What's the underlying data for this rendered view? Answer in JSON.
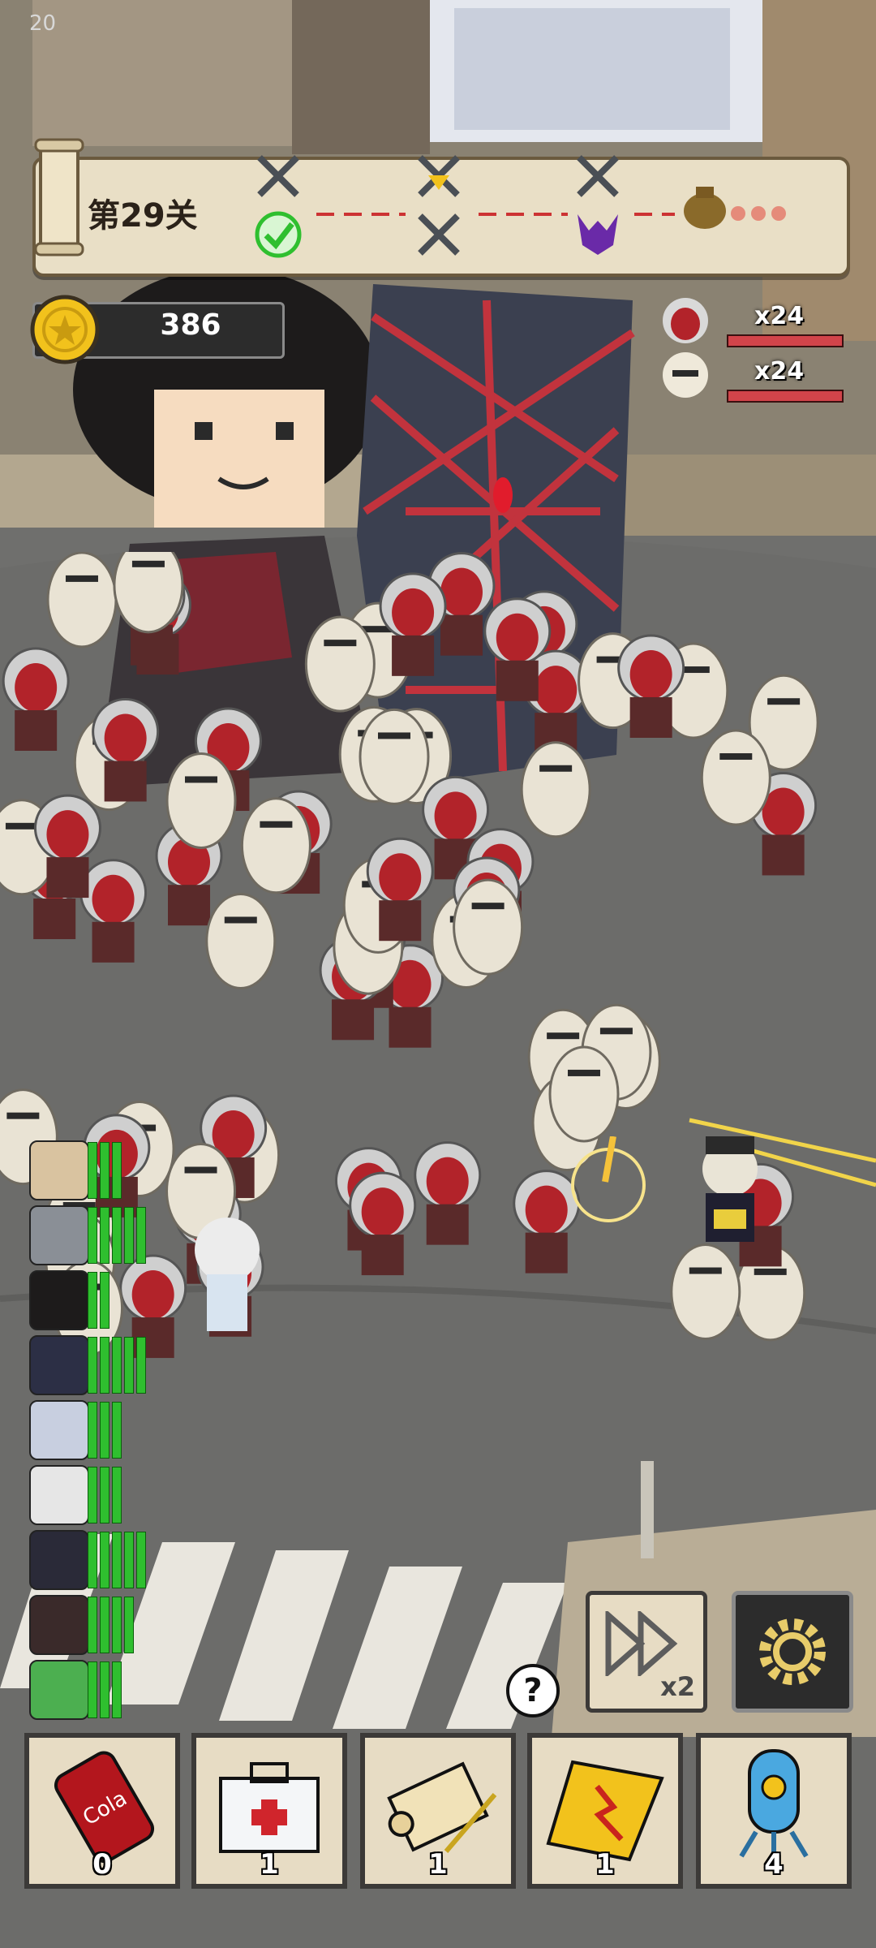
{
  "hud": {
    "fps_counter": "20",
    "stage": {
      "label": "第29关"
    },
    "coins": {
      "value": "386"
    },
    "enemy_waves": [
      {
        "type": "red-masked-hooded",
        "count": "x24",
        "hp_fraction": 1.0
      },
      {
        "type": "white-bandaged",
        "count": "x24",
        "hp_fraction": 1.0
      }
    ]
  },
  "heroes": [
    {
      "name": "cat-cowboy",
      "hp_segments": 3
    },
    {
      "name": "grey-wolf",
      "hp_segments": 5
    },
    {
      "name": "glasses-man",
      "hp_segments": 2
    },
    {
      "name": "ninja",
      "hp_segments": 5
    },
    {
      "name": "pigeon",
      "hp_segments": 3
    },
    {
      "name": "white-hair-elder",
      "hp_segments": 3
    },
    {
      "name": "skeleton-king",
      "hp_segments": 5
    },
    {
      "name": "shield-boy",
      "hp_segments": 4
    },
    {
      "name": "frog",
      "hp_segments": 3
    }
  ],
  "controls": {
    "speed_button": {
      "label": "x2",
      "icon": "fast-forward-icon"
    },
    "settings_button": {
      "icon": "gear-icon"
    },
    "help_button": {
      "label": "?"
    }
  },
  "items": [
    {
      "name": "cola-can",
      "icon": "cola-can-icon",
      "count": "0",
      "can_label": "Cola"
    },
    {
      "name": "first-aid-kit",
      "icon": "medkit-icon",
      "count": "1"
    },
    {
      "name": "scroll-quill",
      "icon": "scroll-icon",
      "count": "1"
    },
    {
      "name": "lightning-talisman",
      "icon": "talisman-icon",
      "count": "1"
    },
    {
      "name": "nuke-bomb",
      "icon": "bomb-icon",
      "count": "4"
    }
  ],
  "colors": {
    "hp_green": "#2fbf2f",
    "enemy_hp_red": "#d2444a",
    "parchment": "#e9dfc6"
  }
}
